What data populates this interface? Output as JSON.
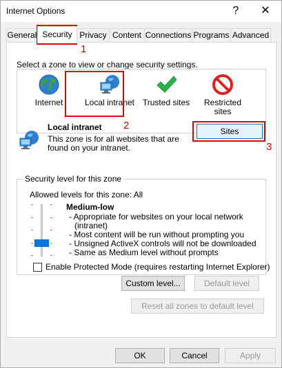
{
  "window": {
    "title": "Internet Options",
    "help_glyph": "?",
    "close_glyph": "✕"
  },
  "tabs": [
    {
      "label": "General"
    },
    {
      "label": "Security"
    },
    {
      "label": "Privacy"
    },
    {
      "label": "Content"
    },
    {
      "label": "Connections"
    },
    {
      "label": "Programs"
    },
    {
      "label": "Advanced"
    }
  ],
  "active_tab": "Security",
  "security": {
    "zone_prompt": "Select a zone to view or change security settings.",
    "zones": [
      {
        "label": "Internet",
        "icon": "globe-icon"
      },
      {
        "label": "Local intranet",
        "icon": "intranet-icon"
      },
      {
        "label": "Trusted sites",
        "icon": "checkmark-icon"
      },
      {
        "label": "Restricted sites",
        "label_line1": "Restricted",
        "label_line2": "sites",
        "icon": "no-entry-icon"
      }
    ],
    "selected_zone": {
      "title": "Local intranet",
      "description_line1": "This zone is for all websites that are",
      "description_line2": "found on your intranet.",
      "icon": "intranet-icon"
    },
    "sites_button": "Sites",
    "level_group": {
      "legend": "Security level for this zone",
      "allowed_levels": "Allowed levels for this zone: All",
      "level_name": "Medium-low",
      "slider_level_of_5": 2,
      "description": [
        "- Appropriate for websites on your local network",
        "(intranet)",
        "- Most content will be run without prompting you",
        "- Unsigned ActiveX controls will not be downloaded",
        "- Same as Medium level without prompts"
      ]
    },
    "protected_mode_label": "Enable Protected Mode (requires restarting Internet Explorer)",
    "protected_mode_checked": false,
    "custom_level_button": "Custom level...",
    "default_level_button": "Default level",
    "reset_all_button": "Reset all zones to default level"
  },
  "footer": {
    "ok": "OK",
    "cancel": "Cancel",
    "apply": "Apply"
  },
  "annotations": [
    {
      "number": "1"
    },
    {
      "number": "2"
    },
    {
      "number": "3"
    }
  ],
  "colors": {
    "annotation_red": "#e00000",
    "slider_thumb": "#0078d7",
    "accent": "#0078d7"
  }
}
